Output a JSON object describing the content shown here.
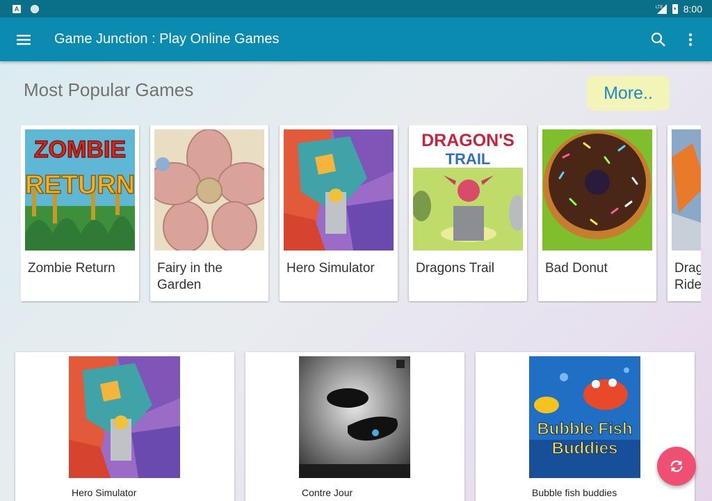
{
  "status_bar": {
    "time": "8:00",
    "network": "LTE"
  },
  "app_bar": {
    "title": "Game Junction : Play Online Games",
    "menu_icon": "hamburger-menu-icon",
    "search_icon": "search-icon",
    "overflow_icon": "more-vert-icon"
  },
  "popular": {
    "section_title": "Most Popular Games",
    "more_label": "More..",
    "games": [
      {
        "name": "Zombie Return",
        "thumb_text_1": "ZOMBIE",
        "thumb_text_2": "RETURN"
      },
      {
        "name": "Fairy in the Garden"
      },
      {
        "name": "Hero Simulator"
      },
      {
        "name": "Dragons Trail",
        "thumb_text_1": "DRAGON'S",
        "thumb_text_2": "TRAIL"
      },
      {
        "name": "Bad Donut"
      },
      {
        "name": "Dragon Rider",
        "display_name": "Drag\nRide"
      }
    ]
  },
  "grid": {
    "games": [
      {
        "name": "Hero Simulator"
      },
      {
        "name": "Contre Jour"
      },
      {
        "name": "Bubble fish buddies",
        "thumb_text_1": "Bubble Fish",
        "thumb_text_2": "Buddies"
      }
    ]
  },
  "fab": {
    "icon": "refresh-icon"
  },
  "colors": {
    "status_bar": "#0a6f88",
    "app_bar": "#0b8bb0",
    "more_button_bg": "#f3f4b8",
    "more_button_text": "#1a8dc0",
    "fab": "#ef4f73"
  }
}
